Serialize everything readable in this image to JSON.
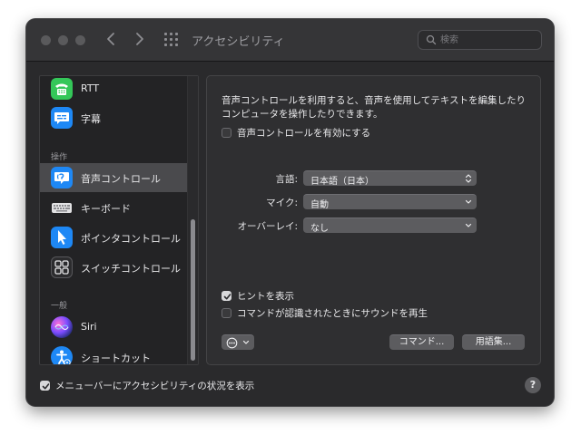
{
  "window": {
    "title": "アクセシビリティ"
  },
  "search": {
    "placeholder": "検索",
    "value": ""
  },
  "sidebar": {
    "items": [
      {
        "label": "RTT",
        "icon": "rtt-icon"
      },
      {
        "label": "字幕",
        "icon": "captions-icon"
      },
      {
        "label": "音声コントロール",
        "icon": "voice-control-icon",
        "selected": true
      },
      {
        "label": "キーボード",
        "icon": "keyboard-icon"
      },
      {
        "label": "ポインタコントロール",
        "icon": "pointer-control-icon"
      },
      {
        "label": "スイッチコントロール",
        "icon": "switch-control-icon"
      },
      {
        "label": "Siri",
        "icon": "siri-icon"
      },
      {
        "label": "ショートカット",
        "icon": "shortcut-icon"
      }
    ],
    "sections": {
      "motor": "操作",
      "general": "一般"
    }
  },
  "panel": {
    "description": "音声コントロールを利用すると、音声を使用してテキストを編集したりコンピュータを操作したりできます。",
    "enable_label": "音声コントロールを有効にする",
    "enable_checked": false,
    "fields": [
      {
        "label": "言語:",
        "value": "日本語（日本）"
      },
      {
        "label": "マイク:",
        "value": "自動"
      },
      {
        "label": "オーバーレイ:",
        "value": "なし"
      }
    ],
    "show_hints_label": "ヒントを表示",
    "show_hints_checked": true,
    "play_sound_label": "コマンドが認識されたときにサウンドを再生",
    "play_sound_checked": false,
    "commands_button": "コマンド...",
    "vocabulary_button": "用語集..."
  },
  "footer": {
    "menubar_label": "メニューバーにアクセシビリティの状況を表示",
    "menubar_checked": true,
    "help_label": "?"
  },
  "colors": {
    "window_bg": "#2a2a2c",
    "selected_row": "#4a4a4d",
    "rtt_green": "#34c759",
    "blue": "#1e88f5"
  }
}
